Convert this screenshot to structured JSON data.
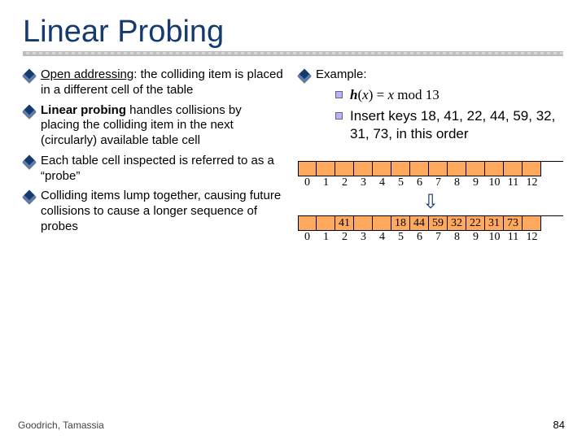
{
  "title": "Linear Probing",
  "left_bullets": [
    {
      "pre": "",
      "strong": "Open addressing",
      "post": ": the colliding item is placed in a different cell of the table",
      "underline": true
    },
    {
      "pre": "",
      "strong": "Linear probing",
      "post": " handles collisions by placing the colliding item in the next (circularly) available table cell",
      "underline": false
    },
    {
      "pre": "Each table cell inspected is referred to as a “probe”",
      "strong": "",
      "post": "",
      "underline": false
    },
    {
      "pre": "Colliding items lump together, causing future collisions to cause a longer sequence of probes",
      "strong": "",
      "post": "",
      "underline": false
    }
  ],
  "right_heading": "Example:",
  "hash_h": "h",
  "hash_open": "(",
  "hash_x": "x",
  "hash_close_eq": ") = ",
  "hash_mod": " mod 13",
  "insert_line": "Insert keys 18, 41, 22, 44, 59, 32, 31, 73, in this order",
  "table1": {
    "cells": [
      "",
      "",
      "",
      "",
      "",
      "",
      "",
      "",
      "",
      "",
      "",
      "",
      ""
    ],
    "labels": [
      "0",
      "1",
      "2",
      "3",
      "4",
      "5",
      "6",
      "7",
      "8",
      "9",
      "10",
      "11",
      "12"
    ]
  },
  "table2": {
    "cells": [
      "",
      "",
      "41",
      "",
      "",
      "18",
      "44",
      "59",
      "32",
      "22",
      "31",
      "73",
      ""
    ],
    "labels": [
      "0",
      "1",
      "2",
      "3",
      "4",
      "5",
      "6",
      "7",
      "8",
      "9",
      "10",
      "11",
      "12"
    ]
  },
  "arrow_glyph": "⇩",
  "footer": "Goodrich, Tamassia",
  "page": "84"
}
